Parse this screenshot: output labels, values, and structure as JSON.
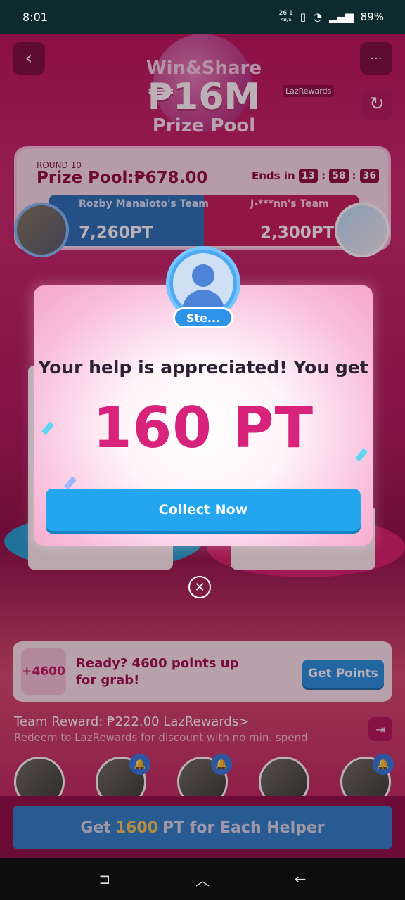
{
  "status": {
    "time": "8:01",
    "net_speed": "26.1",
    "net_unit": "KB/S",
    "battery": "89%"
  },
  "banner": {
    "line1": "Win&Share",
    "line2": "₱16M",
    "line3": "Prize Pool",
    "brand": "LazRewards"
  },
  "round": {
    "label": "ROUND 10",
    "prize_pool": "Prize Pool:₱678.00",
    "ends_label": "Ends in",
    "h": "13",
    "m": "58",
    "s": "36"
  },
  "teams": {
    "left": {
      "name": "Rozby Manaloto's Team",
      "points": "7,260PT"
    },
    "right": {
      "name": "J-***nn's Team",
      "points": "2,300PT"
    }
  },
  "modal": {
    "user_name": "Ste...",
    "title": "Your help is appreciated! You get",
    "points": "160 PT",
    "collect_label": "Collect Now",
    "close_icon": "✕"
  },
  "ready": {
    "badge": "+4600",
    "text": "Ready? 4600 points up for grab!",
    "button": "Get Points"
  },
  "reward": {
    "label": "Team Reward: ₱222.00",
    "brand": "LazRewards>",
    "sub": "Redeem to LazRewards for discount with no min. spend"
  },
  "footer": {
    "pre": "Get ",
    "highlight": "1600",
    "post": " PT for Each Helper"
  },
  "icons": {
    "back": "‹",
    "more": "···",
    "refresh": "↻",
    "bell": "🔔",
    "exit": "⇥"
  },
  "nav": {
    "recent": "⊐",
    "home": "︿",
    "back": "←"
  }
}
